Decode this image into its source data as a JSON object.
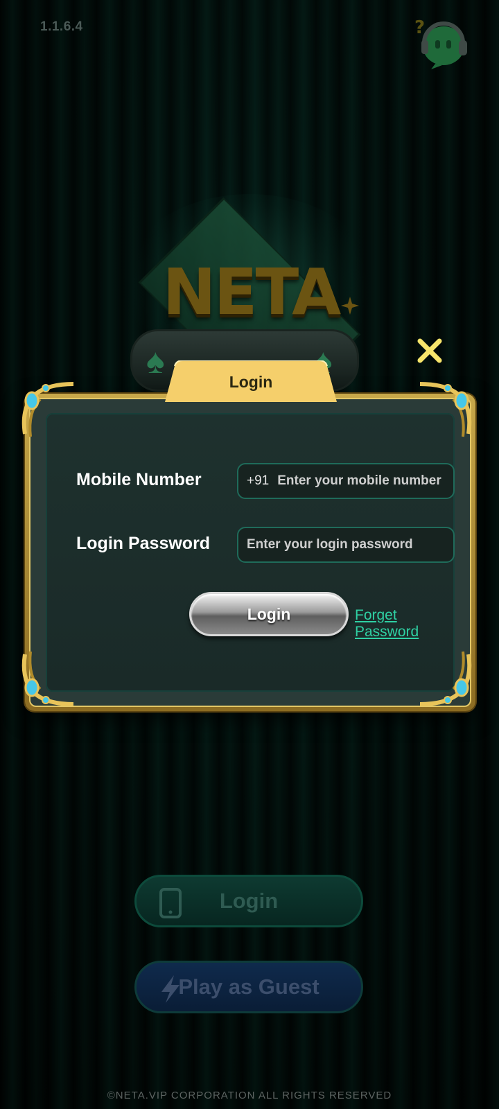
{
  "app": {
    "version": "1.1.6.4",
    "logo_text": "NETA",
    "support_icon": "support-headset-icon"
  },
  "dialog": {
    "title": "Login",
    "mobile_label": "Mobile Number",
    "country_code": "+91",
    "mobile_placeholder": "Enter your mobile number",
    "password_label": "Login Password",
    "password_placeholder": "Enter your login password",
    "login_button": "Login",
    "forget_link": "Forget Password",
    "close_icon": "close-icon"
  },
  "bottom": {
    "login_button": "Login",
    "guest_button": "Play as Guest"
  },
  "footer": "©NETA.VIP CORPORATION ALL RIGHTS RESERVED",
  "colors": {
    "gold": "#e3c766",
    "accent_link": "#2fd1a4",
    "close_x": "#f8e56b"
  }
}
